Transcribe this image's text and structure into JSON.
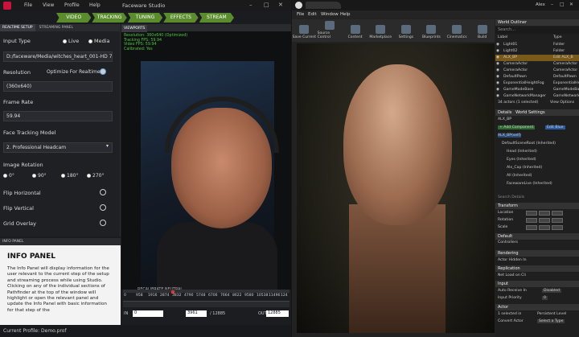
{
  "faceware": {
    "title": "Faceware Studio",
    "menu": [
      "File",
      "View",
      "Profile",
      "Help"
    ],
    "steps": [
      "VIDEO",
      "TRACKING",
      "TUNING",
      "EFFECTS",
      "STREAM"
    ],
    "tabs": [
      "REALTIME SETUP",
      "STREAMING PANEL"
    ],
    "input_type": {
      "label": "Input Type",
      "options": [
        "Live",
        "Media"
      ],
      "selected": "Media"
    },
    "path": "D:/faceware/Media/witches_heart_001-HD 720p",
    "resolution": {
      "label": "Resolution",
      "optimize": "Optimize For Realtime",
      "value": "(360x640)"
    },
    "frame_rate": {
      "label": "Frame Rate",
      "value": "59.94"
    },
    "model": {
      "label": "Face Tracking Model",
      "value": "2. Professional Headcam"
    },
    "rotation": {
      "label": "Image Rotation",
      "options": [
        "0°",
        "90°",
        "180°",
        "270°"
      ]
    },
    "toggles": [
      "Flip Horizontal",
      "Flip Vertical",
      "Grid Overlay"
    ],
    "info": {
      "bar": "INFO PANEL",
      "heading": "INFO PANEL",
      "text": "The Info Panel will display information for the user relevant to the current step of the setup and streaming process while using Studio. Clicking on any of the individual sections of Pathfinder at the top of the window will highlight or open the relevant panel and update the Info Panel with basic information for that step of the"
    },
    "status": "Current Profile: Demo.prof",
    "viewport": {
      "tab": "VIEWPORTS",
      "stats": [
        "Resolution: 360x640 (Optimized)",
        "Tracking FPS: 59.94",
        "Video FPS: 59.94",
        "Calibrated: Yes"
      ],
      "neutral": "RECALIBRATE NEUTRAL"
    },
    "timeline": {
      "ticks": [
        "0",
        "958",
        "1916",
        "2874",
        "3832",
        "4790",
        "5748",
        "6706",
        "7664",
        "8622",
        "9580",
        "10538",
        "11496",
        "124"
      ],
      "in_label": "IN",
      "in_value": "0",
      "current": "3961",
      "total": "/ 12885",
      "out_label": "OUT",
      "out_value": "12885"
    }
  },
  "unreal": {
    "menu": [
      "File",
      "Edit",
      "Window",
      "Help"
    ],
    "user": "Alex",
    "toolbar": [
      "Save Current",
      "Source Control",
      "Content",
      "Marketplace",
      "Settings",
      "Blueprints",
      "Cinematics",
      "Build"
    ],
    "outliner": {
      "title": "World Outliner",
      "search": "Search...",
      "col_label": "Label",
      "col_type": "Type",
      "rows": [
        [
          "Light01",
          "Folder"
        ],
        [
          "Light02",
          "Folder"
        ],
        [
          "ALX_BP",
          "Edit ALX_B"
        ],
        [
          "CameraActor",
          "CameraActor"
        ],
        [
          "CameraActor",
          "CameraActor"
        ],
        [
          "DefaultPawn",
          "DefaultPawn"
        ],
        [
          "ExponentialHeightFog",
          "ExponentialHeig"
        ],
        [
          "GameModeBase",
          "GameModeBase"
        ],
        [
          "GameNetworkManager",
          "GameNetworkMa"
        ]
      ],
      "count": "34 actors (1 selected)",
      "view_options": "View Options"
    },
    "details": {
      "tab1": "Details",
      "tab2": "World Settings",
      "name": "ALX_BP",
      "add": "+ Add Component",
      "edit": "Edit Blue",
      "components": [
        "ALX_BP(self)",
        "DefaultSceneRoot (Inherited)",
        "Head (Inherited)",
        "Eyes (Inherited)",
        "Alx_Cap (Inherited)",
        "All (Inherited)",
        "FacewareLive (Inherited)"
      ],
      "search": "Search Details",
      "transform": "Transform",
      "location": "Location",
      "rotation": "Rotation",
      "scale": "Scale",
      "default": "Default",
      "controllers": "Controllers",
      "rendering": "Rendering",
      "actor_hidden": "Actor Hidden In",
      "replication": "Replication",
      "net_load": "Net Load on Cli",
      "input": "Input",
      "auto_receive": "Auto Receive In",
      "disabled": "Disabled",
      "input_priority": "Input Priority",
      "priority_val": "0",
      "actor": "Actor",
      "selected": "1 selected in",
      "persistent": "Persistent Level",
      "convert": "Convert Actor",
      "select_type": "Select a Type"
    }
  }
}
